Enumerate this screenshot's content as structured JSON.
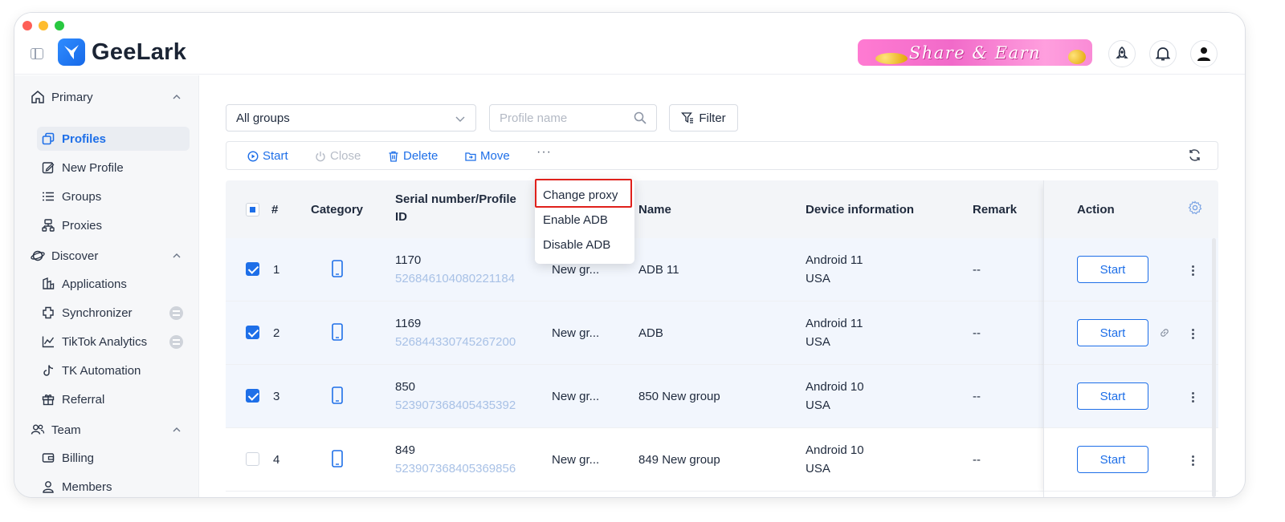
{
  "app": {
    "name": "GeeLark"
  },
  "header": {
    "banner_text": "Share & Earn"
  },
  "sidebar": {
    "sections": [
      {
        "label": "Primary",
        "items": [
          {
            "label": "Profiles",
            "active": true,
            "icon": "profiles-icon"
          },
          {
            "label": "New Profile",
            "icon": "edit-icon"
          },
          {
            "label": "Groups",
            "icon": "list-icon"
          },
          {
            "label": "Proxies",
            "icon": "network-icon"
          }
        ]
      },
      {
        "label": "Discover",
        "items": [
          {
            "label": "Applications",
            "icon": "apps-icon"
          },
          {
            "label": "Synchronizer",
            "icon": "sync-icon",
            "badge": true
          },
          {
            "label": "TikTok Analytics",
            "icon": "chart-icon",
            "badge": true
          },
          {
            "label": "TK Automation",
            "icon": "tiktok-icon"
          },
          {
            "label": "Referral",
            "icon": "gift-icon"
          }
        ]
      },
      {
        "label": "Team",
        "items": [
          {
            "label": "Billing",
            "icon": "wallet-icon"
          },
          {
            "label": "Members",
            "icon": "members-icon"
          }
        ]
      }
    ]
  },
  "filters": {
    "group_select": "All groups",
    "search_placeholder": "Profile name",
    "filter_label": "Filter"
  },
  "toolbar": {
    "start": "Start",
    "close": "Close",
    "delete": "Delete",
    "move": "Move",
    "more": "···"
  },
  "dropdown": {
    "items": [
      "Change proxy",
      "Enable ADB",
      "Disable ADB"
    ],
    "highlighted": "Change proxy"
  },
  "table": {
    "headers": {
      "index": "#",
      "category": "Category",
      "serial_line1": "Serial number/Profile",
      "serial_line2": "ID",
      "name": "Name",
      "device": "Device information",
      "remark": "Remark",
      "action": "Action"
    },
    "rows": [
      {
        "index": "1",
        "serial": "1170",
        "profile_id": "526846104080221184",
        "group": "New gr...",
        "name": "ADB 11",
        "os": "Android 11",
        "region": "USA",
        "remark": "--",
        "checked": true,
        "action": "Start"
      },
      {
        "index": "2",
        "serial": "1169",
        "profile_id": "526844330745267200",
        "group": "New gr...",
        "name": "ADB",
        "os": "Android 11",
        "region": "USA",
        "remark": "--",
        "checked": true,
        "action": "Start"
      },
      {
        "index": "3",
        "serial": "850",
        "profile_id": "523907368405435392",
        "group": "New gr...",
        "name": "850 New group",
        "os": "Android 10",
        "region": "USA",
        "remark": "--",
        "checked": true,
        "action": "Start"
      },
      {
        "index": "4",
        "serial": "849",
        "profile_id": "523907368405369856",
        "group": "New gr...",
        "name": "849 New group",
        "os": "Android 10",
        "region": "USA",
        "remark": "--",
        "checked": false,
        "action": "Start"
      }
    ]
  },
  "colors": {
    "accent": "#1e6fe8",
    "highlight_border": "#e0201b"
  }
}
